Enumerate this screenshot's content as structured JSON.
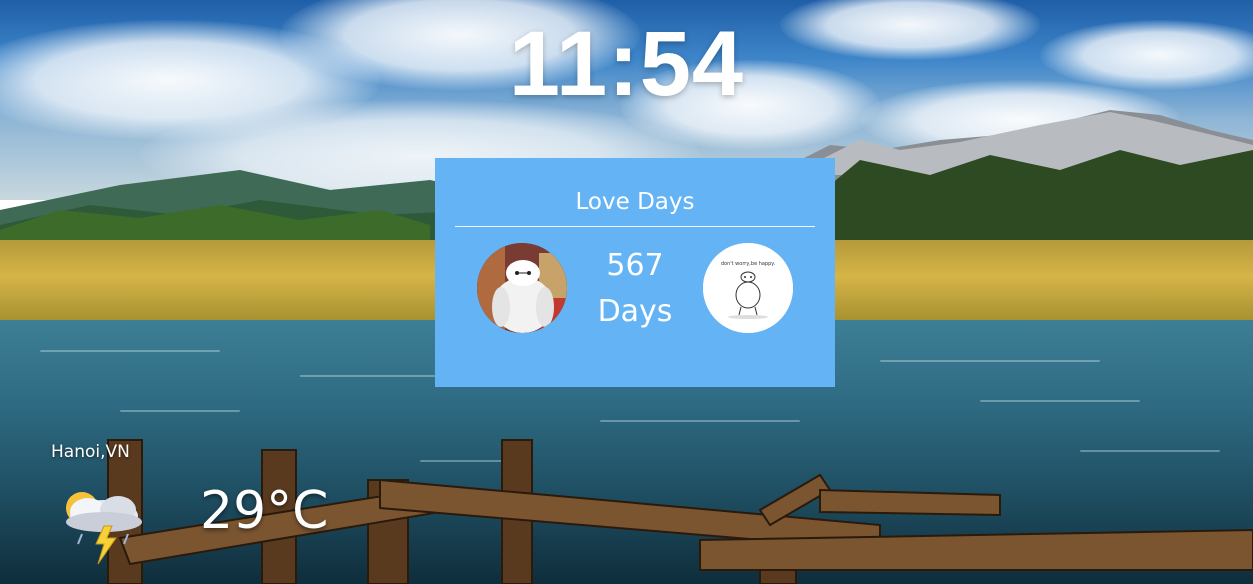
{
  "clock": {
    "time": "11:54"
  },
  "love_card": {
    "title": "Love Days",
    "count": "567",
    "unit": "Days",
    "right_avatar_caption": "don't worry,be happy."
  },
  "weather": {
    "location": "Hanoi,VN",
    "temperature": "29°C",
    "icon": "thunderstorm-sun-icon"
  },
  "colors": {
    "card_background": "#63b3f5",
    "text": "#ffffff"
  }
}
